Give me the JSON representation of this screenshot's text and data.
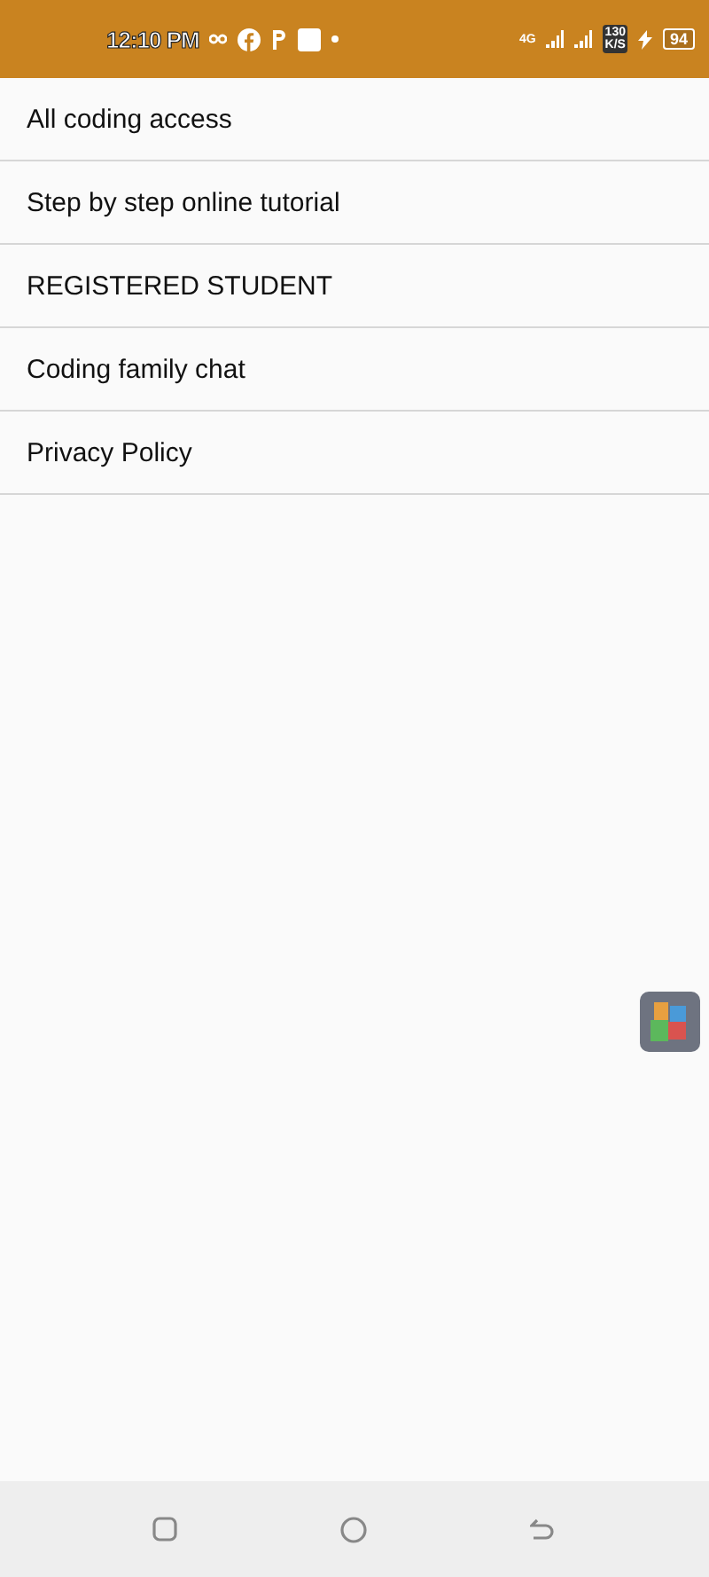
{
  "status_bar": {
    "time": "12:10 PM",
    "network": "4G",
    "speed_value": "130",
    "speed_unit": "K/S",
    "battery": "94"
  },
  "menu": {
    "items": [
      {
        "label": "All coding access"
      },
      {
        "label": "Step by step online tutorial"
      },
      {
        "label": "REGISTERED STUDENT"
      },
      {
        "label": "Coding family chat"
      },
      {
        "label": "Privacy Policy"
      }
    ]
  }
}
